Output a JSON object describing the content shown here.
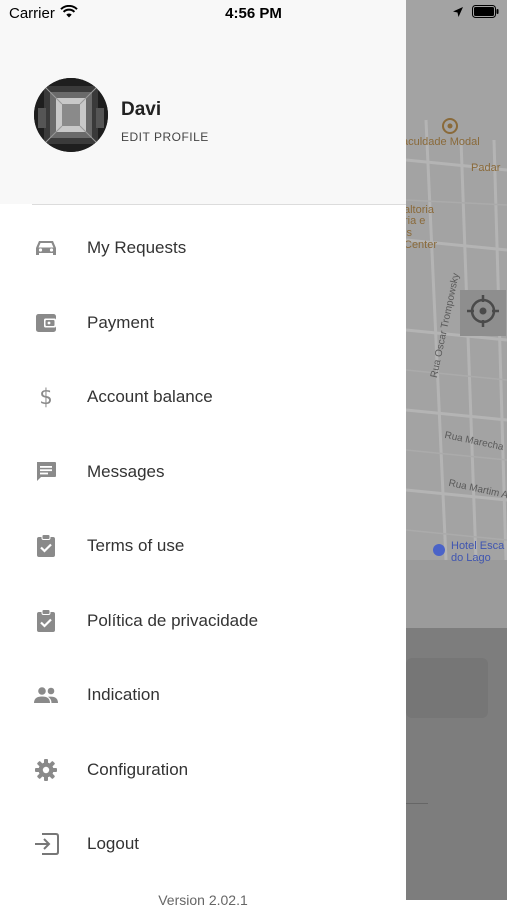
{
  "status_bar": {
    "carrier": "Carrier",
    "time": "4:56 PM",
    "icons": [
      "wifi-icon",
      "location-arrow-icon",
      "battery-icon"
    ]
  },
  "profile": {
    "name": "Davi",
    "edit_label": "EDIT PROFILE"
  },
  "menu": {
    "items": [
      {
        "label": "My Requests",
        "icon": "car-icon"
      },
      {
        "label": "Payment",
        "icon": "wallet-icon"
      },
      {
        "label": "Account balance",
        "icon": "dollar-icon"
      },
      {
        "label": "Messages",
        "icon": "message-icon"
      },
      {
        "label": "Terms of use",
        "icon": "clipboard-check-icon"
      },
      {
        "label": "Política de privacidade",
        "icon": "clipboard-check-icon"
      },
      {
        "label": "Indication",
        "icon": "people-icon"
      },
      {
        "label": "Configuration",
        "icon": "gear-icon"
      },
      {
        "label": "Logout",
        "icon": "exit-icon"
      }
    ]
  },
  "version": "Version 2.02.1",
  "map": {
    "labels": {
      "faculdade": "aculdade Modal",
      "padaria": "Padar",
      "galeria_1": "altoria",
      "galeria_2": "ria e",
      "galeria_3": "is",
      "galeria_4": "Center",
      "rua_oscar": "Rua Oscar Trompowsky",
      "rua_marechal": "Rua Marecha",
      "rua_martim": "Rua Martim A",
      "hotel_1": "Hotel Esca",
      "hotel_2": "do Lago"
    }
  },
  "colors": {
    "drawer_bg": "#ffffff",
    "header_bg": "#f8f8f8",
    "icon_gray": "#8a8a8a",
    "text_dark": "#333333",
    "map_overlay": "#9a9a9a",
    "poi_orange": "#8a6a3a",
    "hotel_blue": "#4a63c8"
  }
}
